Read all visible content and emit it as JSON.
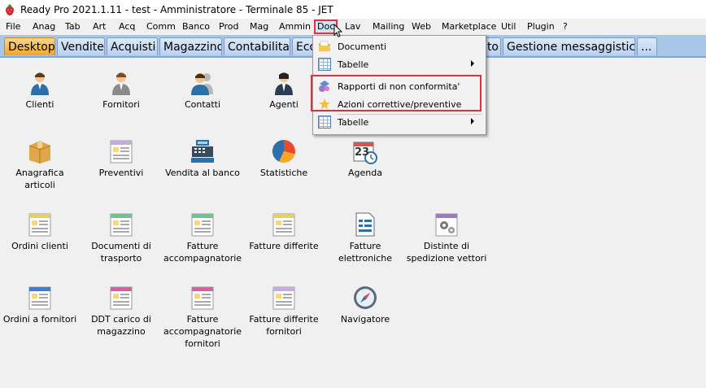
{
  "window": {
    "title": "Ready Pro 2021.1.11 - test - Amministratore - Terminale 85 - JET"
  },
  "menubar": {
    "items": [
      "File",
      "Anag",
      "Tab",
      "Art",
      "Acq",
      "Comm",
      "Banco",
      "Prod",
      "Mag",
      "Ammin",
      "Doc",
      "Lav",
      "Mailing",
      "Web",
      "Marketplace",
      "Util",
      "Plugin",
      "?"
    ],
    "active": "Doc"
  },
  "tabs": [
    "Desktop",
    "Vendite",
    "Acquisti",
    "Magazzino",
    "Contabilita'",
    "Eco",
    "to",
    "Gestione messaggistica",
    "..."
  ],
  "dropdown": {
    "items": [
      {
        "label": "Documenti",
        "icon": "folder-documents-icon",
        "submenu": false
      },
      {
        "label": "Tabelle",
        "icon": "table-icon",
        "submenu": true
      },
      {
        "label": "Rapporti di non conformita'",
        "icon": "nonconformity-report-icon",
        "submenu": false
      },
      {
        "label": "Azioni correttive/preventive",
        "icon": "corrective-action-icon",
        "submenu": false
      },
      {
        "label": "Tabelle",
        "icon": "table-icon",
        "submenu": true
      }
    ]
  },
  "desktop": {
    "row1": [
      "Clienti",
      "Fornitori",
      "Contatti",
      "Agenti"
    ],
    "row2": [
      "Anagrafica articoli",
      "Preventivi",
      "Vendita al banco",
      "Statistiche",
      "Agenda"
    ],
    "row3": [
      "Ordini clienti",
      "Documenti di trasporto",
      "Fatture accompagnatorie",
      "Fatture differite",
      "Fatture elettroniche",
      "Distinte di spedizione vettori"
    ],
    "row4": [
      "Ordini a fornitori",
      "DDT carico di magazzino",
      "Fatture accompagnatorie fornitori",
      "Fatture differite fornitori",
      "Navigatore"
    ],
    "agenda_day": "23"
  },
  "colors": {
    "accent_red": "#e0323c",
    "tab_active": "#f5a623",
    "tab_bar": "#a8c6e8"
  }
}
